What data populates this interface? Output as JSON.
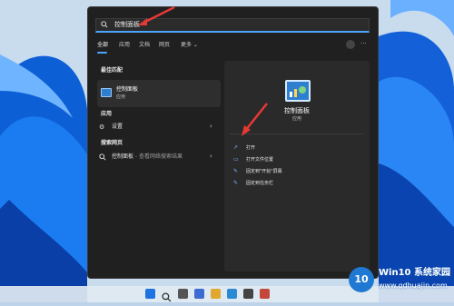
{
  "search": {
    "query": "控制面板"
  },
  "tabs": {
    "all": "全部",
    "apps": "应用",
    "docs": "文档",
    "web": "网页",
    "more": "更多 ⌄"
  },
  "left": {
    "best_match_title": "最佳匹配",
    "best_match_name": "控制面板",
    "best_match_type": "应用",
    "apps_title": "应用",
    "settings_label": "设置",
    "web_title": "搜索网页",
    "web_query": "控制面板",
    "web_suffix": " - 查看网络搜索结果"
  },
  "right": {
    "app_name": "控制面板",
    "app_type": "应用",
    "actions": [
      "打开",
      "打开文件位置",
      "固定到\"开始\"屏幕",
      "固定到任务栏"
    ]
  },
  "watermark": {
    "logo": "10",
    "name": "Win10 系统家园",
    "url": "www.qdhuajin.com"
  },
  "colors": {
    "accent": "#4aa3ff",
    "panel": "#202020",
    "icon_blue": "#2f7fd1",
    "arrow": "#e53935"
  }
}
